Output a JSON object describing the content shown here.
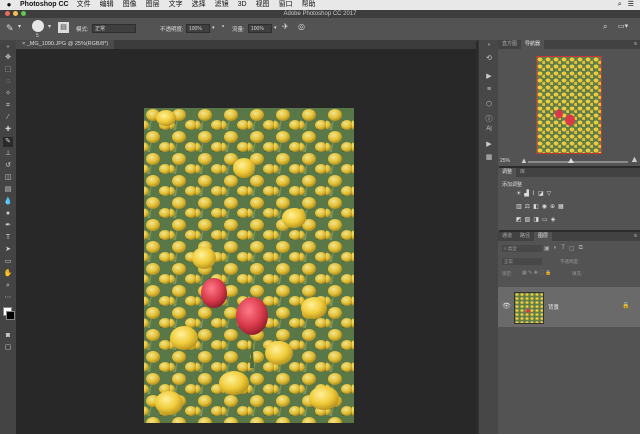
{
  "menubar": {
    "app_name": "Photoshop CC",
    "items": [
      "文件",
      "编辑",
      "图像",
      "图层",
      "文字",
      "选择",
      "滤镜",
      "3D",
      "视图",
      "窗口",
      "帮助"
    ]
  },
  "window": {
    "title": "Adobe Photoshop CC 2017"
  },
  "options_bar": {
    "brush_size": "5",
    "mode_label": "模式:",
    "mode_value": "正常",
    "opacity_label": "不透明度:",
    "opacity_value": "100%",
    "flow_label": "流量:",
    "flow_value": "100%"
  },
  "document": {
    "tab_label": "_MG_1090.JPG @ 25%(RGB/8*)"
  },
  "navigator": {
    "tabs": [
      "直方图",
      "导航器"
    ],
    "zoom": "25%"
  },
  "adjustments": {
    "tabs": [
      "调整",
      "库"
    ],
    "add_label": "添加调整"
  },
  "layers": {
    "tabs": [
      "通道",
      "路径",
      "图层"
    ],
    "kind_label": "类型",
    "normal_label": "正常",
    "opacity_label": "不透明度:",
    "lock_label": "锁定:",
    "fill_label": "填充:",
    "layer_name": "背景"
  },
  "colors": {
    "accent_red": "#d93a3a",
    "tulip_yellow": "#f0cc3a",
    "panel_bg": "#535353"
  }
}
